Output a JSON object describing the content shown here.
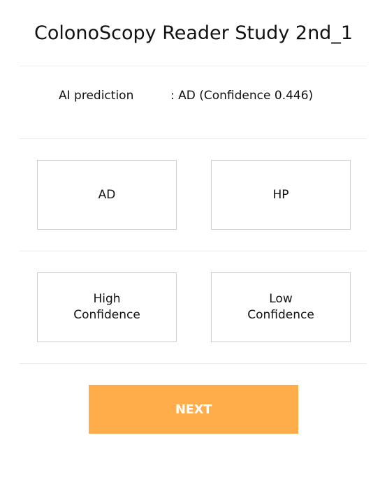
{
  "header": {
    "title": "ColonoScopy Reader Study 2nd_1"
  },
  "prediction": {
    "label": "AI prediction",
    "value": ": AD (Confidence 0.446)"
  },
  "diagnosis_choices": [
    {
      "label": "AD"
    },
    {
      "label": "HP"
    }
  ],
  "confidence_choices": [
    {
      "label": "High\nConfidence"
    },
    {
      "label": "Low\nConfidence"
    }
  ],
  "actions": {
    "next_label": "NEXT"
  },
  "colors": {
    "accent": "#ffad4a",
    "button_text": "#ffffff",
    "border": "#cfcfcf",
    "divider": "#ececec",
    "text": "#111111"
  }
}
